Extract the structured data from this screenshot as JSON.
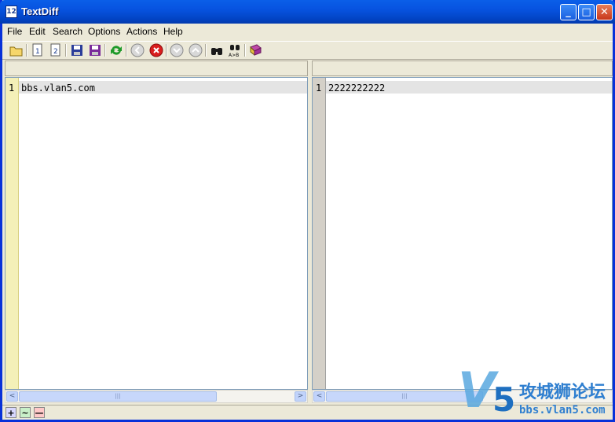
{
  "window": {
    "title": "TextDiff",
    "controls": {
      "minimize": "_",
      "maximize": "□",
      "close": "✕"
    }
  },
  "menu": {
    "file": "File",
    "edit": "Edit",
    "search": "Search",
    "options": "Options",
    "actions": "Actions",
    "help": "Help"
  },
  "toolbar": {
    "icons": [
      "open-folder-icon",
      "open-file-1-icon",
      "open-file-2-icon",
      "save-file-1-icon",
      "save-file-2-icon",
      "refresh-compare-icon",
      "prev-diff-icon",
      "stop-icon",
      "next-diff-icon",
      "first-diff-icon",
      "find-icon",
      "find-replace-icon",
      "book-help-icon"
    ]
  },
  "left_pane": {
    "lines": [
      {
        "number": "1",
        "text": "bbs.vlan5.com"
      }
    ]
  },
  "right_pane": {
    "lines": [
      {
        "number": "1",
        "text": "2222222222"
      }
    ]
  },
  "scrollbars": {
    "left_arrow": "<",
    "right_arrow": ">",
    "thumb_grip": "|||"
  },
  "status_bar": {
    "added": "+",
    "changed": "~",
    "removed": "—",
    "colors": {
      "added": "#d7d7ff",
      "changed": "#c8f0c8",
      "removed": "#ffc8c8"
    }
  },
  "watermark": {
    "logo": "V5",
    "text": "攻城狮论坛",
    "url": "bbs.vlan5.com"
  }
}
